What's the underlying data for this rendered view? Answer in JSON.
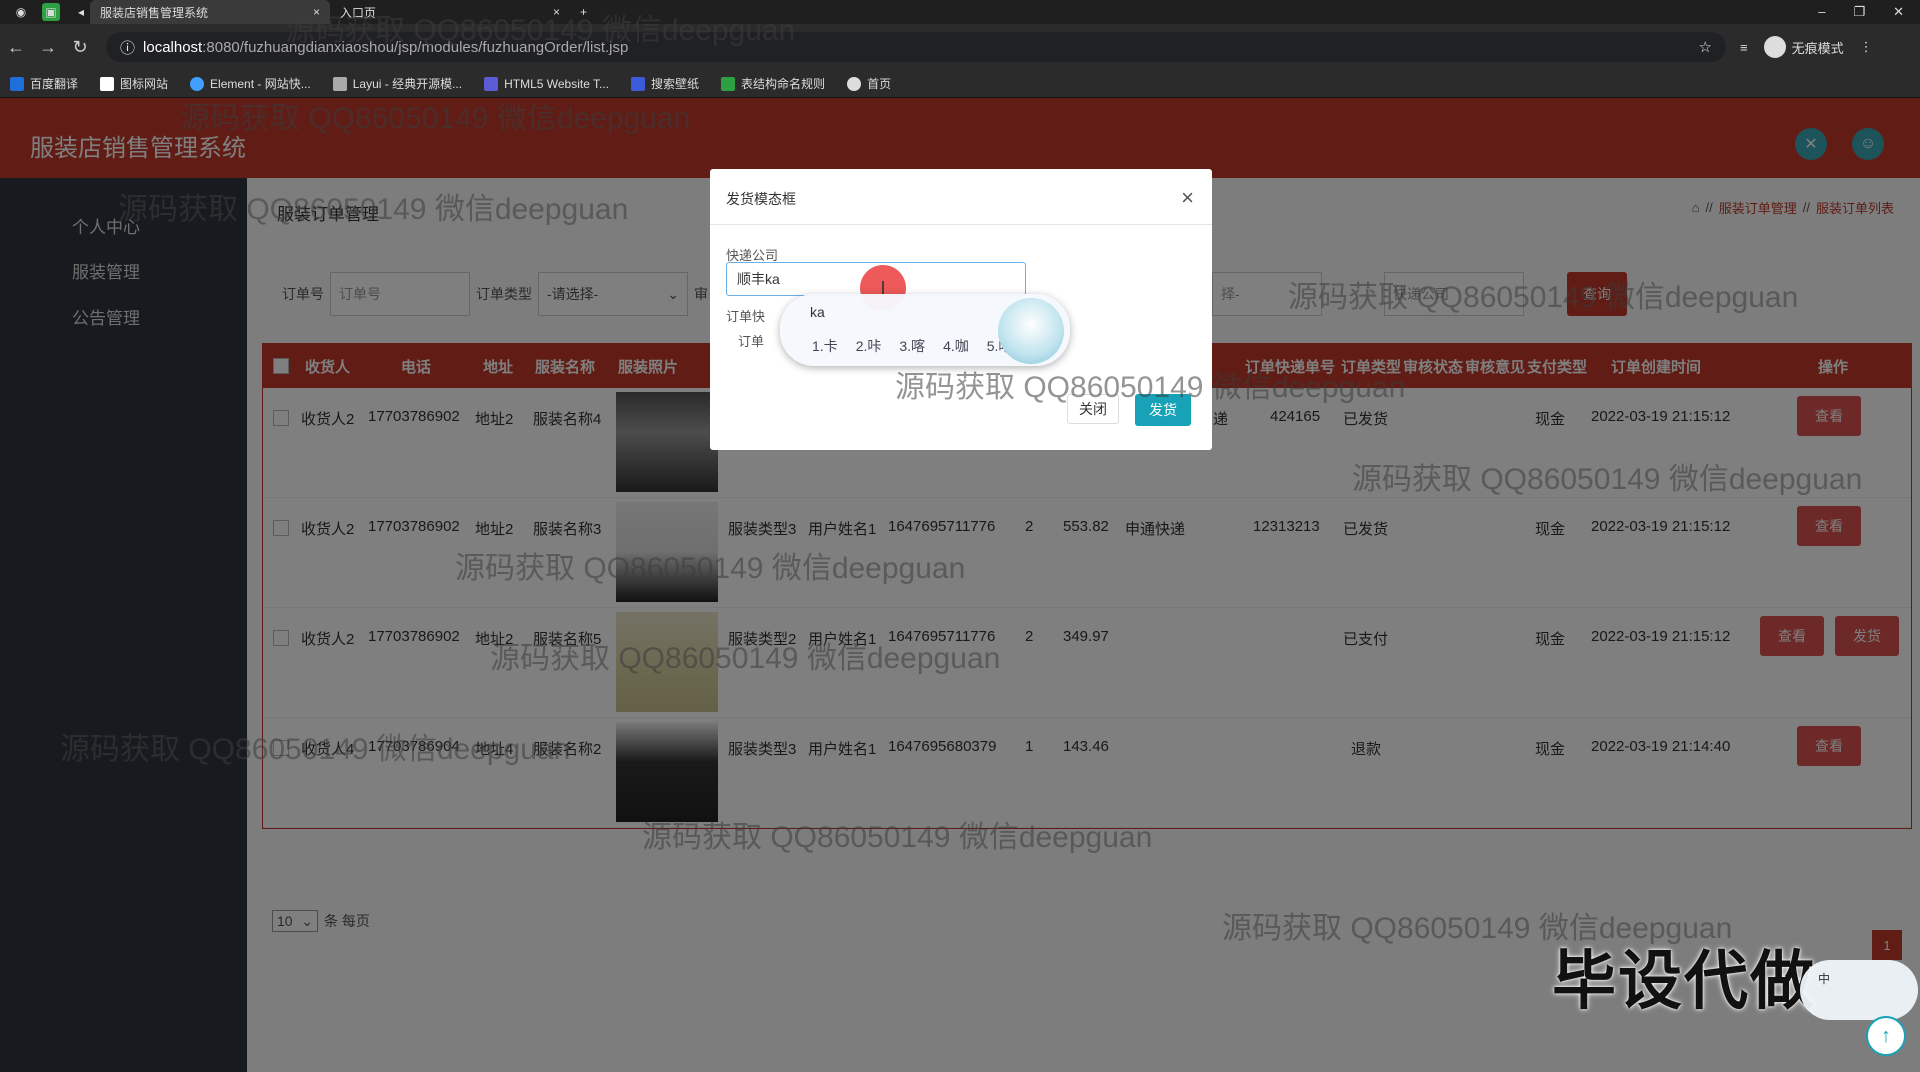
{
  "browser": {
    "tabs": [
      {
        "label": "服装店销售管理系统",
        "active": true
      },
      {
        "label": "入口页",
        "active": false
      }
    ],
    "new_tab": "+",
    "url_host": "localhost",
    "url_path": ":8080/fuzhuangdianxiaoshou/jsp/modules/fuzhuangOrder/list.jsp",
    "incognito_label": "无痕模式",
    "bookmarks": [
      "百度翻译",
      "图标网站",
      "Element - 网站快...",
      "Layui - 经典开源模...",
      "HTML5 Website T...",
      "搜索壁纸",
      "表结构命名规则",
      "首页"
    ]
  },
  "app": {
    "title": "服装店销售管理系统",
    "sidebar": [
      {
        "label": "个人中心"
      },
      {
        "label": "服装管理"
      },
      {
        "label": "公告管理"
      }
    ],
    "page_title": "服装订单管理",
    "breadcrumb": [
      "服装订单管理",
      "服装订单列表"
    ],
    "breadcrumb_sep": "//",
    "filters": {
      "order_no_label": "订单号",
      "order_no_placeholder": "订单号",
      "order_type_label": "订单类型",
      "order_type_value": "-请选择-",
      "audit_label": "审",
      "right_select_value": "择-",
      "right_input_placeholder": "快递公司",
      "search_label": "查询"
    },
    "table": {
      "headers": [
        "收货人",
        "电话",
        "地址",
        "服装名称",
        "服装照片",
        "订单快递单号",
        "订单类型",
        "审核状态",
        "审核意见",
        "支付类型",
        "订单创建时间",
        "操作"
      ],
      "rows": [
        {
          "receiver": "收货人2",
          "phone": "17703786902",
          "address": "地址2",
          "name": "服装名称4",
          "type": "",
          "user": "",
          "order_no": "",
          "qty": "",
          "price": "",
          "express": "递",
          "express_no": "424165",
          "status": "已发货",
          "pay": "现金",
          "created": "2022-03-19 21:15:12",
          "actions": [
            "查看"
          ]
        },
        {
          "receiver": "收货人2",
          "phone": "17703786902",
          "address": "地址2",
          "name": "服装名称3",
          "type": "服装类型3",
          "user": "用户姓名1",
          "order_no": "1647695711776",
          "qty": "2",
          "price": "553.82",
          "express": "申通快递",
          "express_no": "12313213",
          "status": "已发货",
          "pay": "现金",
          "created": "2022-03-19 21:15:12",
          "actions": [
            "查看"
          ]
        },
        {
          "receiver": "收货人2",
          "phone": "17703786902",
          "address": "地址2",
          "name": "服装名称5",
          "type": "服装类型2",
          "user": "用户姓名1",
          "order_no": "1647695711776",
          "qty": "2",
          "price": "349.97",
          "express": "",
          "express_no": "",
          "status": "已支付",
          "pay": "现金",
          "created": "2022-03-19 21:15:12",
          "actions": [
            "查看",
            "发货"
          ]
        },
        {
          "receiver": "收货人4",
          "phone": "17703786904",
          "address": "地址4",
          "name": "服装名称2",
          "type": "服装类型3",
          "user": "用户姓名1",
          "order_no": "1647695680379",
          "qty": "1",
          "price": "143.46",
          "express": "",
          "express_no": "",
          "status": "退款",
          "pay": "现金",
          "created": "2022-03-19 21:14:40",
          "actions": [
            "查看"
          ]
        }
      ]
    },
    "pager": {
      "page_size": "10",
      "suffix": "条 每页",
      "current_page": "1"
    }
  },
  "modal": {
    "title": "发货模态框",
    "close_icon": "×",
    "company_label": "快递公司",
    "company_value": "顺丰ka",
    "tracking_label": "订单快",
    "order_label": "订单",
    "close_label": "关闭",
    "ship_label": "发货"
  },
  "ime": {
    "composition": "ka",
    "candidates": [
      "1.卡",
      "2.咔",
      "3.喀",
      "4.咖",
      "5.喀"
    ],
    "corner_label": "中"
  },
  "watermark": "源码获取 QQ86050149 微信deepguan",
  "banner": "毕设代做"
}
